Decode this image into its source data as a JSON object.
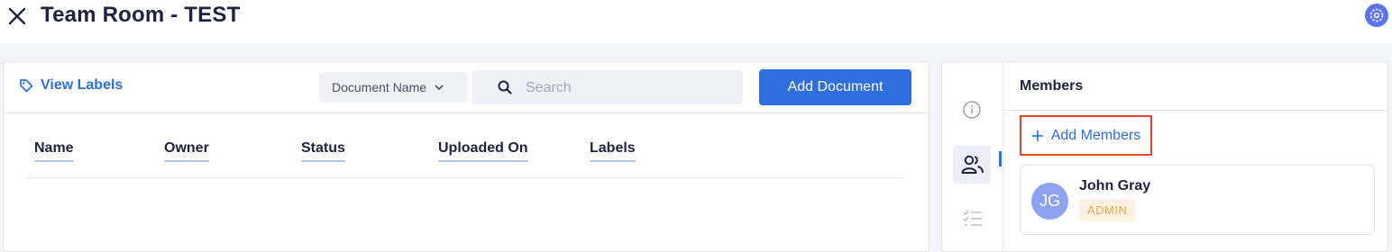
{
  "header": {
    "title": "Team Room - TEST",
    "close_icon": "close-icon",
    "settings_icon": "gear-icon"
  },
  "documents": {
    "view_labels": "View Labels",
    "filter_select": {
      "selected": "Document Name"
    },
    "search": {
      "placeholder": "Search",
      "value": ""
    },
    "add_button": "Add Document",
    "columns": [
      "Name",
      "Owner",
      "Status",
      "Uploaded On",
      "Labels"
    ],
    "rows": []
  },
  "side_panel": {
    "rail": [
      "info-icon",
      "members-icon",
      "tasks-icon"
    ],
    "members_title": "Members",
    "add_members": "Add Members",
    "members": [
      {
        "initials": "JG",
        "name": "John Gray",
        "role": "ADMIN"
      }
    ]
  },
  "colors": {
    "accent": "#2f6fdd",
    "highlight_border": "#e2462f",
    "admin_badge_text": "#f0a64a",
    "avatar_bg": "#8ea3ef"
  }
}
